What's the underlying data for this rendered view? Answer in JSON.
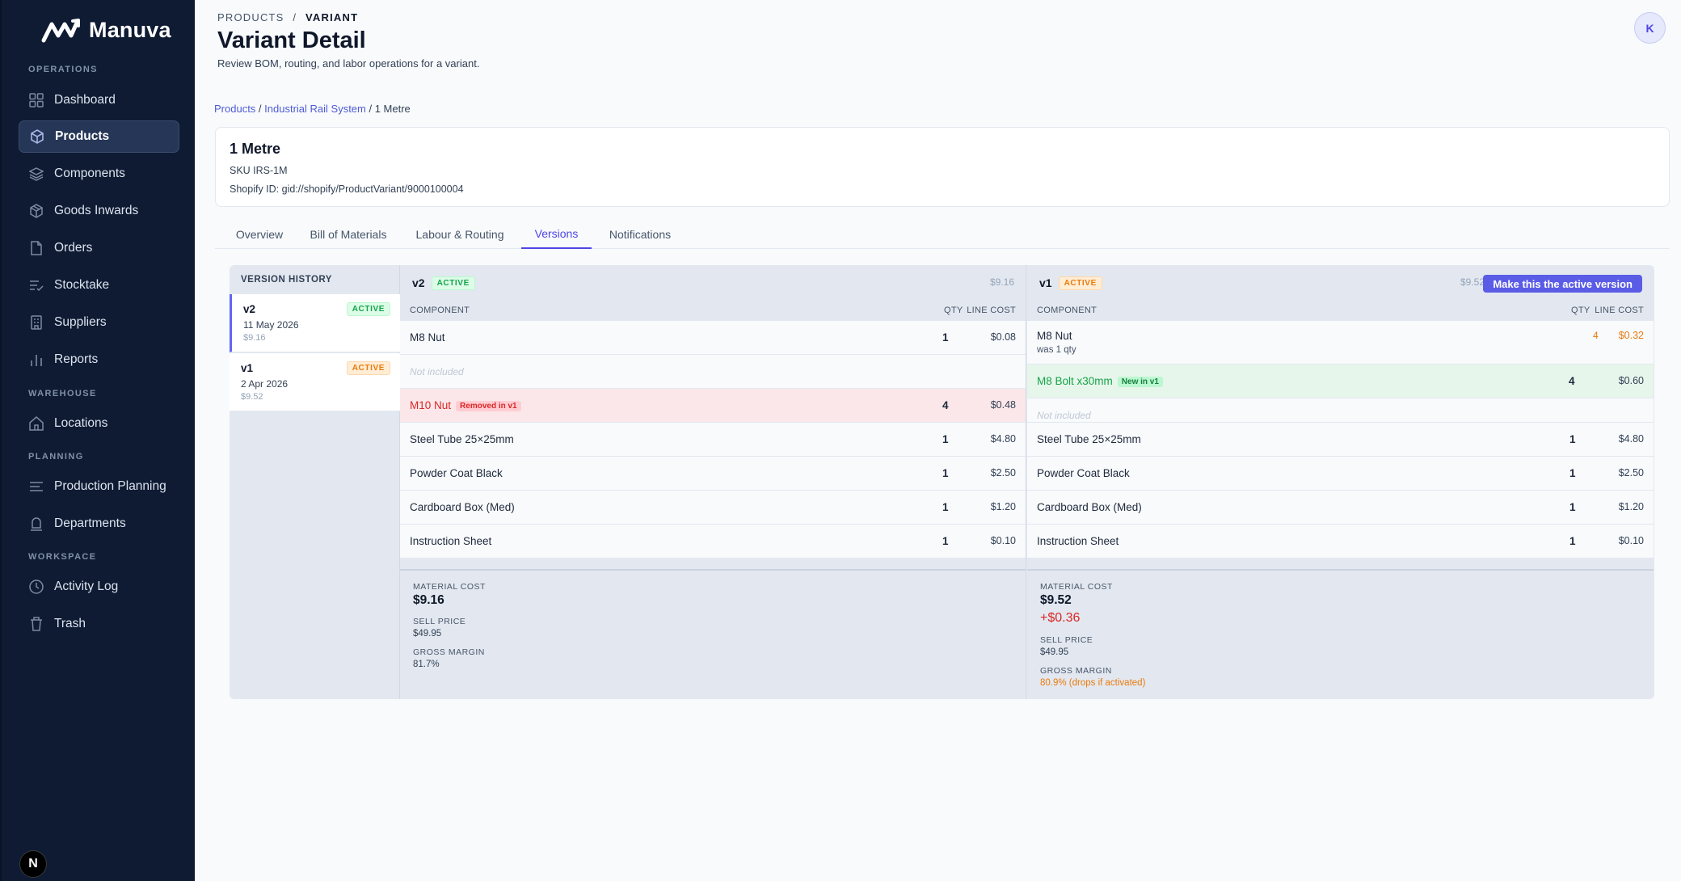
{
  "app": {
    "name": "Manuva"
  },
  "sidebar": {
    "sections": [
      {
        "label": "OPERATIONS"
      },
      {
        "label": "WAREHOUSE"
      },
      {
        "label": "PLANNING"
      },
      {
        "label": "WORKSPACE"
      }
    ],
    "items": [
      {
        "label": "Dashboard",
        "icon": "grid-icon"
      },
      {
        "label": "Products",
        "icon": "box-icon",
        "active": true
      },
      {
        "label": "Components",
        "icon": "layers-icon"
      },
      {
        "label": "Goods Inwards",
        "icon": "package-icon"
      },
      {
        "label": "Orders",
        "icon": "file-icon"
      },
      {
        "label": "Stocktake",
        "icon": "list-check-icon"
      },
      {
        "label": "Suppliers",
        "icon": "building-icon"
      },
      {
        "label": "Reports",
        "icon": "bar-chart-icon"
      },
      {
        "label": "Locations",
        "icon": "home-icon"
      },
      {
        "label": "Production Planning",
        "icon": "lines-icon"
      },
      {
        "label": "Departments",
        "icon": "bell-icon"
      },
      {
        "label": "Activity Log",
        "icon": "clock-icon"
      },
      {
        "label": "Trash",
        "icon": "trash-icon"
      }
    ],
    "bottom_badge": "N"
  },
  "header": {
    "crumb_parent": "PRODUCTS",
    "crumb_sep": "/",
    "crumb_current": "VARIANT",
    "title": "Variant Detail",
    "subtitle": "Review BOM, routing, and labor operations for a variant.",
    "avatar": "K"
  },
  "path": {
    "products": "Products",
    "product": "Industrial Rail System",
    "variant": "1 Metre",
    "sep": " / "
  },
  "variant": {
    "name": "1 Metre",
    "sku": "SKU IRS-1M",
    "shopify": "Shopify ID: gid://shopify/ProductVariant/9000100004"
  },
  "tabs": [
    {
      "label": "Overview"
    },
    {
      "label": "Bill of Materials"
    },
    {
      "label": "Labour & Routing"
    },
    {
      "label": "Versions",
      "active": true
    },
    {
      "label": "Notifications"
    }
  ],
  "version_history": {
    "title": "VERSION HISTORY",
    "items": [
      {
        "version": "v2",
        "badge": "ACTIVE",
        "date": "11 May 2026",
        "cost": "$9.16"
      },
      {
        "version": "v1",
        "badge": "ACTIVE",
        "date": "2 Apr 2026",
        "cost": "$9.52"
      }
    ]
  },
  "columns": {
    "component": "COMPONENT",
    "qty": "QTY",
    "line_cost": "LINE COST"
  },
  "left": {
    "version": "v2",
    "badge": "ACTIVE",
    "cost": "$9.16",
    "rows": [
      {
        "name": "M8 Nut",
        "qty": "1",
        "cost": "$0.08"
      },
      {
        "name": "Not included"
      },
      {
        "name": "M10 Nut",
        "tag": "Removed in v1",
        "qty": "4",
        "cost": "$0.48"
      },
      {
        "name": "Steel Tube 25×25mm",
        "qty": "1",
        "cost": "$4.80"
      },
      {
        "name": "Powder Coat Black",
        "qty": "1",
        "cost": "$2.50"
      },
      {
        "name": "Cardboard Box (Med)",
        "qty": "1",
        "cost": "$1.20"
      },
      {
        "name": "Instruction Sheet",
        "qty": "1",
        "cost": "$0.10"
      }
    ],
    "summary": {
      "material_label": "MATERIAL COST",
      "material": "$9.16",
      "sell_label": "SELL PRICE",
      "sell": "$49.95",
      "margin_label": "GROSS MARGIN",
      "margin": "81.7%"
    }
  },
  "right": {
    "version": "v1",
    "badge": "ACTIVE",
    "cost": "$9.52",
    "action": "Make this the active version",
    "rows": [
      {
        "name": "M8 Nut",
        "was": "was 1 qty",
        "qty": "4",
        "cost": "$0.32"
      },
      {
        "name": "M8 Bolt x30mm",
        "tag": "New in v1",
        "qty": "4",
        "cost": "$0.60"
      },
      {
        "name": "Not included"
      },
      {
        "name": "Steel Tube 25×25mm",
        "qty": "1",
        "cost": "$4.80"
      },
      {
        "name": "Powder Coat Black",
        "qty": "1",
        "cost": "$2.50"
      },
      {
        "name": "Cardboard Box (Med)",
        "qty": "1",
        "cost": "$1.20"
      },
      {
        "name": "Instruction Sheet",
        "qty": "1",
        "cost": "$0.10"
      }
    ],
    "summary": {
      "material_label": "MATERIAL COST",
      "material": "$9.52",
      "delta": "+$0.36",
      "sell_label": "SELL PRICE",
      "sell": "$49.95",
      "margin_label": "GROSS MARGIN",
      "margin": "80.9% (drops if activated)"
    }
  },
  "colors": {
    "accent": "#5b5ce6",
    "sidebar": "#0f1b33",
    "active_green": "#16a34a",
    "active_orange": "#ea7a0c",
    "removed": "#dc2626"
  }
}
